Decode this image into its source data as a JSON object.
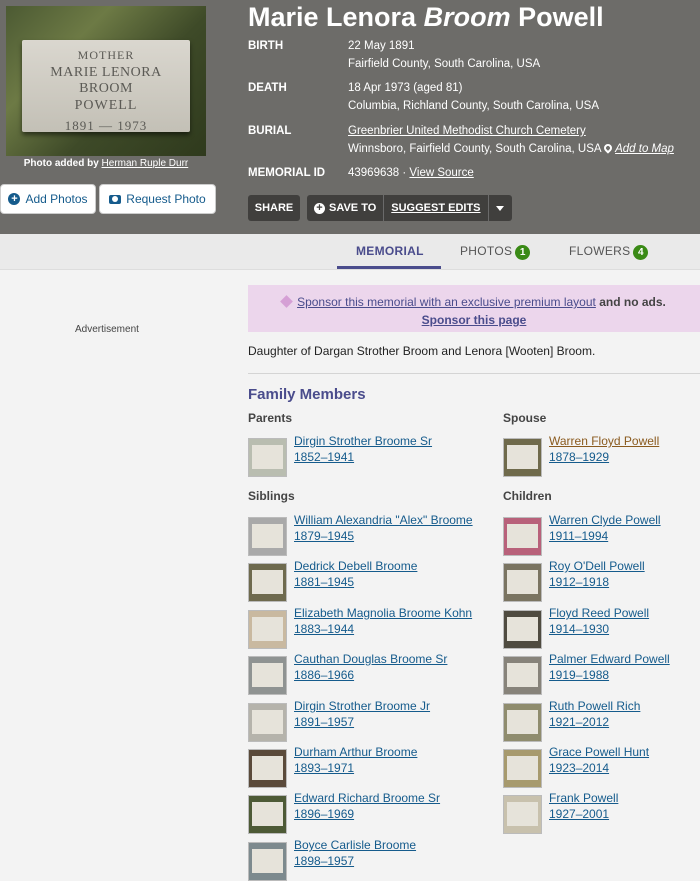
{
  "header": {
    "name_first": "Marie Lenora",
    "name_maiden": "Broom",
    "name_last": "Powell",
    "photo": {
      "inscription": [
        "MOTHER",
        "MARIE LENORA BROOM",
        "POWELL",
        "1891 — 1973"
      ],
      "caption_prefix": "Photo added by",
      "caption_author": "Herman Ruple Durr"
    },
    "add_photos": "Add Photos",
    "request_photo": "Request Photo",
    "birth": {
      "label": "BIRTH",
      "date": "22 May 1891",
      "place": "Fairfield County, South Carolina, USA"
    },
    "death": {
      "label": "DEATH",
      "date": "18 Apr 1973 (aged 81)",
      "place": "Columbia, Richland County, South Carolina, USA"
    },
    "burial": {
      "label": "BURIAL",
      "cemetery": "Greenbrier United Methodist Church Cemetery",
      "place": "Winnsboro, Fairfield County, South Carolina, USA",
      "add_to_map": "Add to Map"
    },
    "memorial_id": {
      "label": "MEMORIAL ID",
      "value": "43969638",
      "sep": "·",
      "view_source": "View Source"
    },
    "buttons": {
      "share": "SHARE",
      "save_to": "SAVE TO",
      "suggest_edits": "SUGGEST EDITS"
    }
  },
  "tabs": [
    {
      "label": "MEMORIAL",
      "badge": ""
    },
    {
      "label": "PHOTOS",
      "badge": "1"
    },
    {
      "label": "FLOWERS",
      "badge": "4"
    }
  ],
  "advertisement": "Advertisement",
  "sponsor": {
    "text": "Sponsor this memorial with an exclusive premium layout",
    "bold": "and no ads.",
    "link": "Sponsor this page"
  },
  "bio": "Daughter of Dargan Strother Broom and Lenora [Wooten] Broom.",
  "family": {
    "title": "Family Members",
    "parents_title": "Parents",
    "spouse_title": "Spouse",
    "siblings_title": "Siblings",
    "children_title": "Children",
    "parents": [
      {
        "name": "Dirgin Strother Broome Sr",
        "years": "1852–1941"
      }
    ],
    "spouse": [
      {
        "name": "Warren Floyd Powell",
        "years": "1878–1929"
      }
    ],
    "siblings": [
      {
        "name": "William Alexandria \"Alex\" Broome",
        "years": "1879–1945"
      },
      {
        "name": "Dedrick Debell Broome",
        "years": "1881–1945"
      },
      {
        "name": "Elizabeth Magnolia Broome Kohn",
        "years": "1883–1944"
      },
      {
        "name": "Cauthan Douglas Broome Sr",
        "years": "1886–1966"
      },
      {
        "name": "Dirgin Strother Broome Jr",
        "years": "1891–1957"
      },
      {
        "name": "Durham Arthur Broome",
        "years": "1893–1971"
      },
      {
        "name": "Edward Richard Broome Sr",
        "years": "1896–1969"
      },
      {
        "name": "Boyce Carlisle Broome",
        "years": "1898–1957"
      }
    ],
    "children": [
      {
        "name": "Warren Clyde Powell",
        "years": "1911–1994"
      },
      {
        "name": "Roy O'Dell Powell",
        "years": "1912–1918"
      },
      {
        "name": "Floyd Reed Powell",
        "years": "1914–1930"
      },
      {
        "name": "Palmer Edward Powell",
        "years": "1919–1988"
      },
      {
        "name": "Ruth Powell Rich",
        "years": "1921–2012"
      },
      {
        "name": "Grace Powell Hunt",
        "years": "1923–2014"
      },
      {
        "name": "Frank Powell",
        "years": "1927–2001"
      }
    ]
  },
  "colors": {
    "header_bg": "#6d6c69",
    "accent": "#4a4c8c",
    "link": "#155b8c",
    "badge": "#3a8a16",
    "sponsor_bg": "#ecd6ec"
  }
}
